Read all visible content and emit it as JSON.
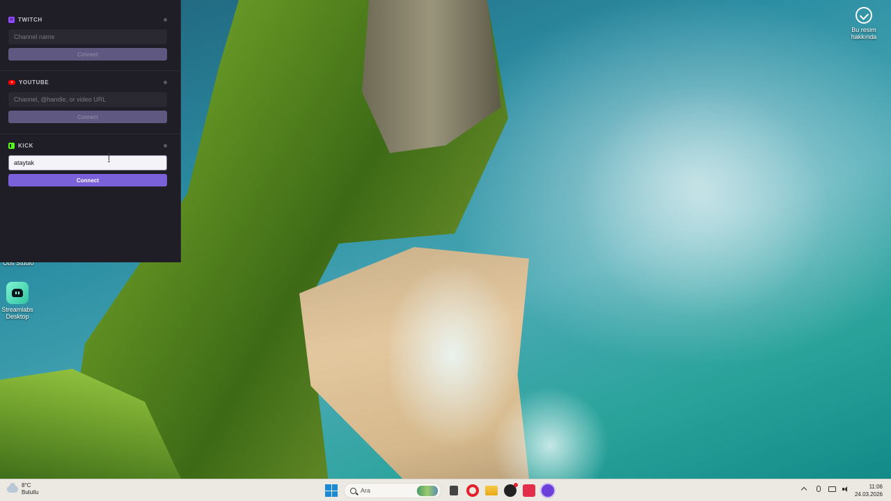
{
  "desktop": {
    "about_image_label": "Bu resim hakkında",
    "obs_label": "Obs Studio",
    "streamlabs_label": "Streamlabs Desktop"
  },
  "panel": {
    "twitch": {
      "title": "TWITCH",
      "placeholder": "Channel name",
      "value": "",
      "button": "Connect"
    },
    "youtube": {
      "title": "YOUTUBE",
      "placeholder": "Channel, @handle, or video URL",
      "value": "",
      "button": "Connect"
    },
    "kick": {
      "title": "KICK",
      "placeholder": "",
      "value": "ataytak",
      "button": "Connect"
    }
  },
  "taskbar": {
    "weather_temp": "8°C",
    "weather_desc": "Bulutlu",
    "search_placeholder": "Ara",
    "time": "11:06",
    "date": "24.03.2026"
  },
  "colors": {
    "panel_bg": "#1f1d25",
    "twitch": "#9147ff",
    "youtube": "#ff0000",
    "kick": "#53fc18",
    "connect_enabled": "#7b61d9",
    "connect_disabled": "#5f5880"
  }
}
